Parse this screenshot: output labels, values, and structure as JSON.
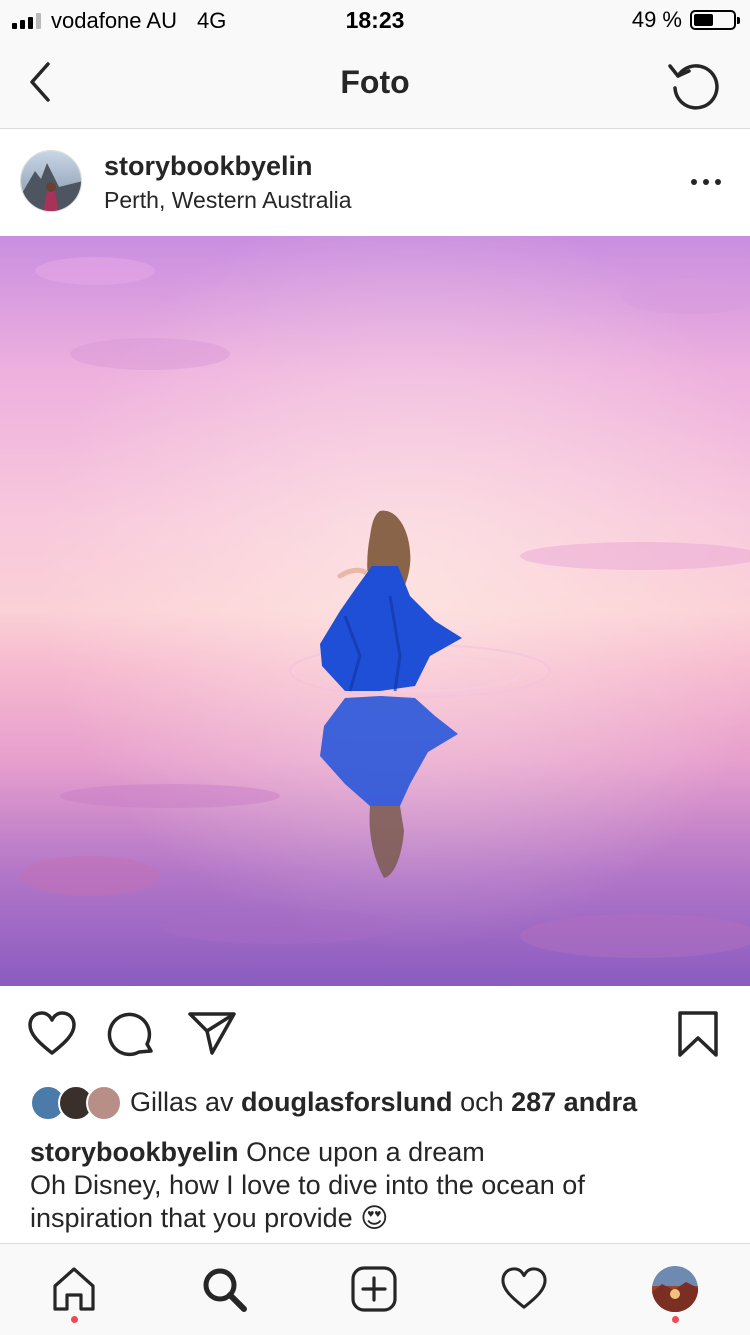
{
  "status_bar": {
    "carrier": "vodafone AU",
    "network": "4G",
    "time": "18:23",
    "battery_percent": "49 %",
    "battery_level": 0.49
  },
  "nav": {
    "title": "Foto",
    "back_icon": "chevron-left-icon",
    "refresh_icon": "refresh-icon"
  },
  "post": {
    "username": "storybookbyelin",
    "location": "Perth, Western Australia",
    "more_icon": "ellipsis-icon",
    "photo_icon": "photo-image"
  },
  "actions": {
    "like_icon": "heart-icon",
    "comment_icon": "comment-icon",
    "share_icon": "send-icon",
    "save_icon": "bookmark-icon"
  },
  "likes": {
    "prefix": "Gillas av",
    "user": "douglasforslund",
    "conjunction": "och",
    "others": "287 andra"
  },
  "caption": {
    "username": "storybookbyelin",
    "text_line1": "Once upon a dream",
    "text_line2": "Oh Disney, how I love to dive into the ocean of",
    "text_line3": "inspiration that you provide",
    "emoji": "😍"
  },
  "tab_bar": {
    "items": [
      "home-icon",
      "search-icon",
      "add-post-icon",
      "activity-icon",
      "profile-avatar"
    ]
  },
  "colors": {
    "notification_dot": "#ed4956",
    "dress_blue": "#1f4fd6",
    "sky_pink": "#f3b4dc"
  }
}
